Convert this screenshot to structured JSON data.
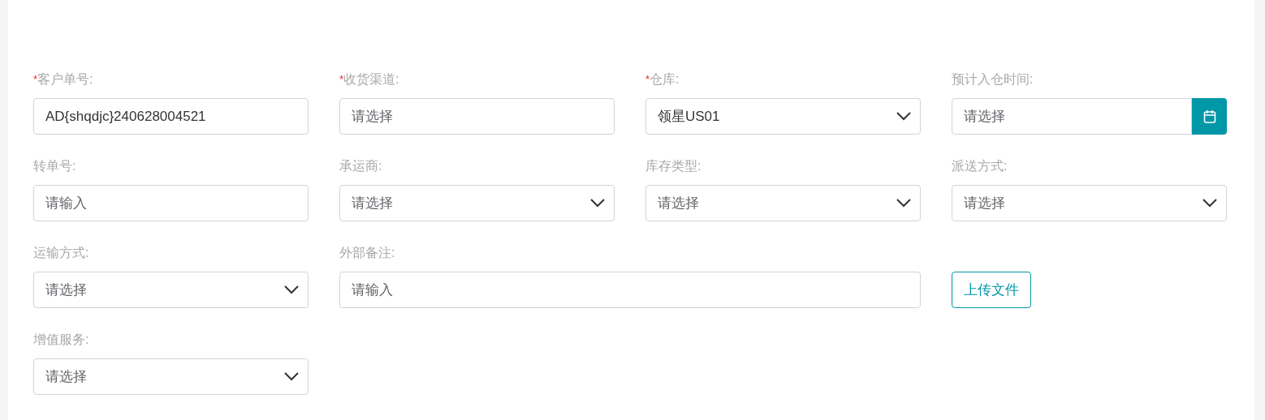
{
  "fields": [
    {
      "kind": "text",
      "mark": "*",
      "label": "客户单号:",
      "required": true,
      "value": "AD{shqdjc}240628004521"
    },
    {
      "kind": "text",
      "mark": "*",
      "label": "收货渠道:",
      "required": true,
      "placeholder": "请选择"
    },
    {
      "kind": "select",
      "mark": "*",
      "label": "仓库:",
      "required": true,
      "value": "领星US01"
    },
    {
      "kind": "date",
      "label": "预计入仓时间:",
      "required": false,
      "placeholder": "请选择"
    },
    {
      "kind": "text",
      "label": "转单号:",
      "required": false,
      "placeholder": "请输入"
    },
    {
      "kind": "select",
      "label": "承运商:",
      "required": false,
      "placeholder": "请选择"
    },
    {
      "kind": "select",
      "label": "库存类型:",
      "required": false,
      "placeholder": "请选择"
    },
    {
      "kind": "select",
      "label": "派送方式:",
      "required": false,
      "placeholder": "请选择"
    },
    {
      "kind": "select",
      "label": "运输方式:",
      "required": false,
      "placeholder": "请选择"
    },
    {
      "kind": "note",
      "label": "外部备注:",
      "required": false,
      "placeholder": "请输入"
    },
    {
      "kind": "upload",
      "button": "上传文件"
    },
    {
      "kind": "select",
      "label": "增值服务:",
      "required": false,
      "placeholder": "请选择"
    }
  ]
}
